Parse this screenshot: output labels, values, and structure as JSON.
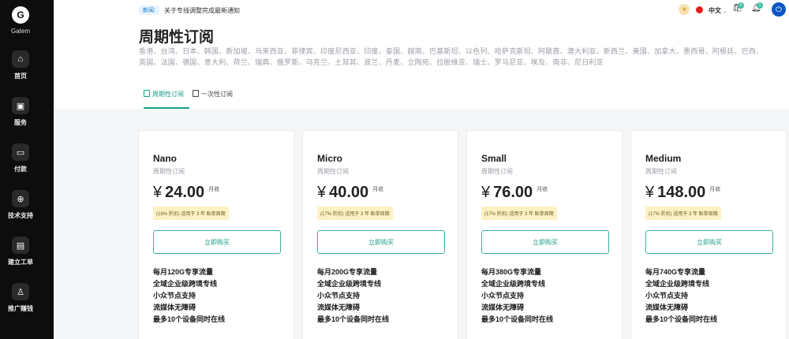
{
  "sidebar": {
    "logo": "G",
    "brand": "Gatem",
    "items": [
      {
        "label": "首页",
        "icon": "home-icon",
        "glyph": "⌂"
      },
      {
        "label": "服务",
        "icon": "package-icon",
        "glyph": "▣"
      },
      {
        "label": "付款",
        "icon": "credit-card-icon",
        "glyph": "▭"
      },
      {
        "label": "技术支持",
        "icon": "globe-icon",
        "glyph": "⊕"
      },
      {
        "label": "建立工单",
        "icon": "ticket-icon",
        "glyph": "▤"
      },
      {
        "label": "推广赚钱",
        "icon": "user-plus-icon",
        "glyph": "♙"
      }
    ]
  },
  "topbar": {
    "notice_badge": "新闻:",
    "notice_text": "关于专线调整完成最新通知",
    "language": "中文",
    "cart_count": "0",
    "bell_count": "1"
  },
  "header": {
    "title": "周期性订阅",
    "regions": "香港、台湾、日本、韩国、新加坡、马来西亚、菲律宾、印度尼西亚、印度、泰国、越南、巴基斯坦、以色列、哈萨克斯坦、阿联酋、澳大利亚、新西兰、美国、加拿大、墨西哥、阿根廷、巴西、英国、法国、德国、意大利、荷兰、瑞典、俄罗斯、乌克兰、土耳其、波兰、丹麦、立陶宛、拉脱维亚、瑞士、罗马尼亚、埃及、南非、尼日利亚",
    "tabs": [
      {
        "label": "周期性订阅",
        "active": true
      },
      {
        "label": "一次性订阅",
        "active": false
      }
    ]
  },
  "plans": [
    {
      "name": "Nano",
      "subtitle": "周期性订阅",
      "currency": "¥",
      "price": "24.00",
      "period": "月收",
      "discount": "(18% 折扣) 适用于 3 年 账单周期",
      "button": "立即购买",
      "features": [
        "每月120G专享流量",
        "全域企业级跨境专线",
        "小众节点支持",
        "流媒体无障碍",
        "最多10个设备同时在线"
      ]
    },
    {
      "name": "Micro",
      "subtitle": "周期性订阅",
      "currency": "¥",
      "price": "40.00",
      "period": "月收",
      "discount": "(17% 折扣) 适用于 3 年 账单周期",
      "button": "立即购买",
      "features": [
        "每月200G专享流量",
        "全域企业级跨境专线",
        "小众节点支持",
        "流媒体无障碍",
        "最多10个设备同时在线"
      ]
    },
    {
      "name": "Small",
      "subtitle": "周期性订阅",
      "currency": "¥",
      "price": "76.00",
      "period": "月收",
      "discount": "(17% 折扣) 适用于 3 年 账单周期",
      "button": "立即购买",
      "features": [
        "每月380G专享流量",
        "全域企业级跨境专线",
        "小众节点支持",
        "流媒体无障碍",
        "最多10个设备同时在线"
      ]
    },
    {
      "name": "Medium",
      "subtitle": "周期性订阅",
      "currency": "¥",
      "price": "148.00",
      "period": "月收",
      "discount": "(17% 折扣) 适用于 3 年 账单周期",
      "button": "立即购买",
      "features": [
        "每月740G专享流量",
        "全域企业级跨境专线",
        "小众节点支持",
        "流媒体无障碍",
        "最多10个设备同时在线"
      ]
    }
  ],
  "colors": {
    "accent": "#1a9e8a",
    "sidebar": "#0d0d0d",
    "discount_bg": "#fdf1c4"
  }
}
